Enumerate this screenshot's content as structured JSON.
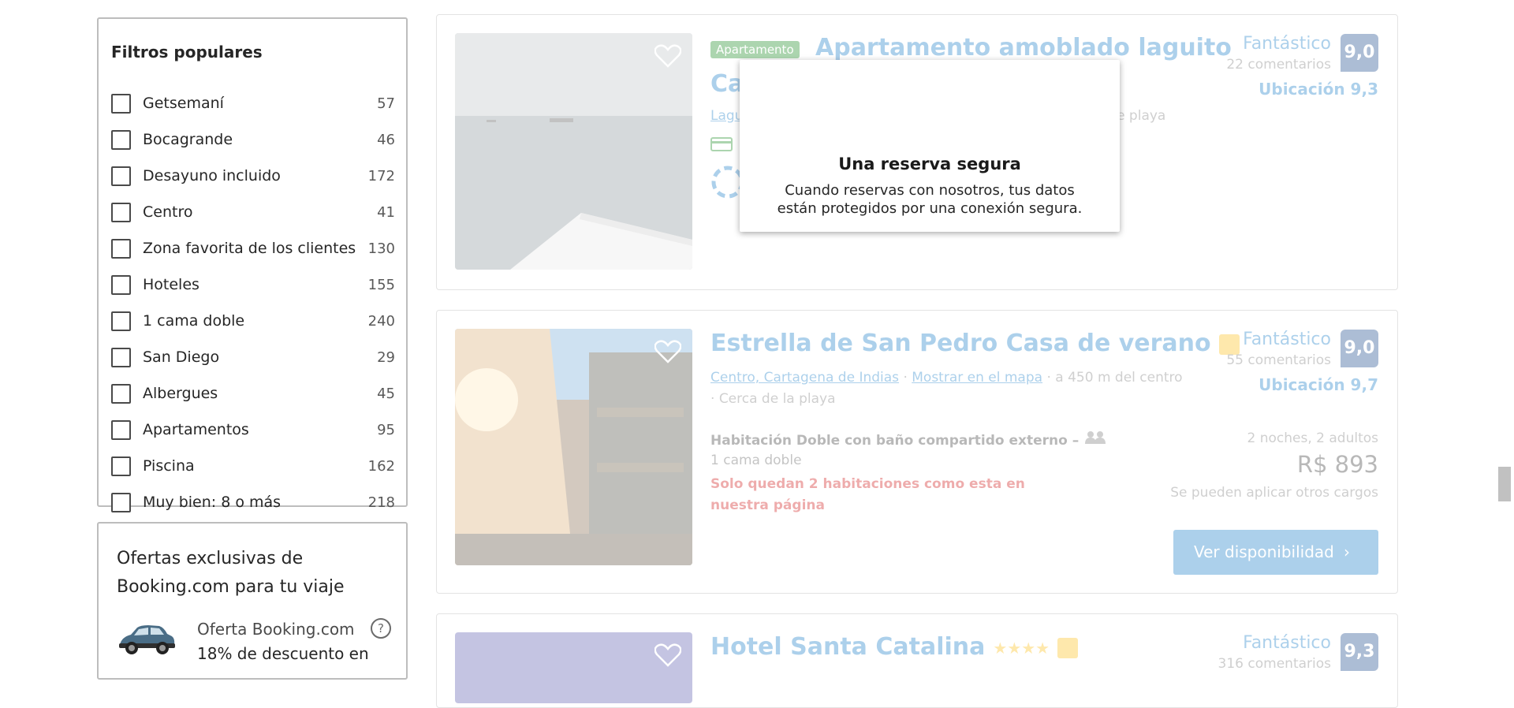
{
  "filters": {
    "title": "Filtros populares",
    "items": [
      {
        "label": "Getsemaní",
        "count": "57"
      },
      {
        "label": "Bocagrande",
        "count": "46"
      },
      {
        "label": "Desayuno incluido",
        "count": "172"
      },
      {
        "label": "Centro",
        "count": "41"
      },
      {
        "label": "Zona favorita de los clientes",
        "count": "130"
      },
      {
        "label": "Hoteles",
        "count": "155"
      },
      {
        "label": "1 cama doble",
        "count": "240"
      },
      {
        "label": "San Diego",
        "count": "29"
      },
      {
        "label": "Albergues",
        "count": "45"
      },
      {
        "label": "Apartamentos",
        "count": "95"
      },
      {
        "label": "Piscina",
        "count": "162"
      },
      {
        "label": "Muy bien: 8 o más",
        "count": "218"
      }
    ]
  },
  "offers": {
    "title": "Ofertas exclusivas de Booking.com para tu viaje",
    "brand": "Oferta Booking.com",
    "discount": "18% de descuento en",
    "help_symbol": "?"
  },
  "card1": {
    "badge": "Apartamento",
    "title_line1": "Apartamento amoblado laguito",
    "title_line2": "Ca",
    "location_link": "Lagu",
    "distance_tail": "ea de playa",
    "rating_word": "Fantástico",
    "review_count": "22 comentarios",
    "score": "9,0",
    "location_score": "Ubicación 9,3"
  },
  "card2": {
    "title": "Estrella de San Pedro Casa de verano",
    "location_link": "Centro, Cartagena de Indias",
    "map_link": "Mostrar en el mapa",
    "distance": "a 450 m del centro",
    "beach": "Cerca de la playa",
    "rating_word": "Fantástico",
    "review_count": "55 comentarios",
    "score": "9,0",
    "location_score": "Ubicación 9,7",
    "room_name": "Habitación Doble con baño compartido externo",
    "room_bed": "1 cama doble",
    "scarcity": "Solo quedan 2 habitaciones como esta en nuestra página",
    "nights": "2 noches, 2 adultos",
    "price": "R$ 893",
    "charges": "Se pueden aplicar otros cargos",
    "button": "Ver disponibilidad",
    "button_chevron": "›"
  },
  "card3": {
    "title": "Hotel Santa Catalina",
    "stars": "★★★★",
    "rating_word": "Fantástico",
    "review_count": "316 comentarios",
    "score": "9,3"
  },
  "modal": {
    "title": "Una reserva segura",
    "body": "Cuando reservas con nosotros, tus datos están protegidos por una conexión segura."
  },
  "colors": {
    "brand_blue": "#0071c2",
    "score_navy": "#003580",
    "scarcity_red": "#cc0000",
    "badge_green": "#008009"
  }
}
